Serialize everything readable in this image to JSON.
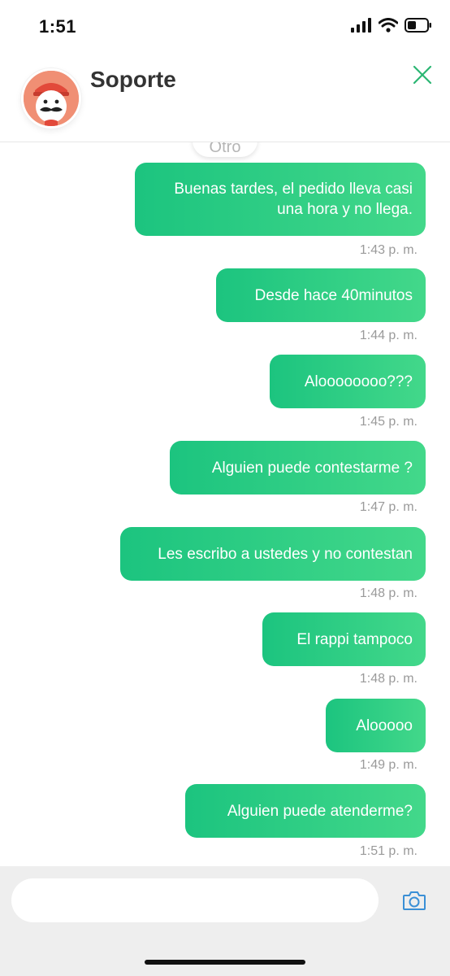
{
  "status_bar": {
    "time": "1:51"
  },
  "header": {
    "title": "Soporte",
    "avatar": "mustache-mascot-avatar",
    "close_icon": "close-icon"
  },
  "chat": {
    "date_chip": "Otro",
    "messages": [
      {
        "text": "Buenas tardes, el pedido lleva casi una hora y no llega.",
        "time": "1:43 p. m."
      },
      {
        "text": "Desde hace 40minutos",
        "time": "1:44 p. m."
      },
      {
        "text": "Aloooooooo???",
        "time": "1:45 p. m."
      },
      {
        "text": "Alguien puede contestarme ?",
        "time": "1:47 p. m."
      },
      {
        "text": "Les escribo a ustedes y no contestan",
        "time": "1:48 p. m."
      },
      {
        "text": "El rappi tampoco",
        "time": "1:48 p. m."
      },
      {
        "text": "Alooooo",
        "time": "1:49 p. m."
      },
      {
        "text": "Alguien puede atenderme?",
        "time": "1:51 p. m."
      }
    ]
  },
  "composer": {
    "input_value": "",
    "placeholder": "",
    "camera_icon": "camera-icon"
  },
  "colors": {
    "bubble_start": "#1cc47f",
    "bubble_end": "#43d88a",
    "accent": "#2bb673",
    "camera": "#3a8fd6"
  }
}
